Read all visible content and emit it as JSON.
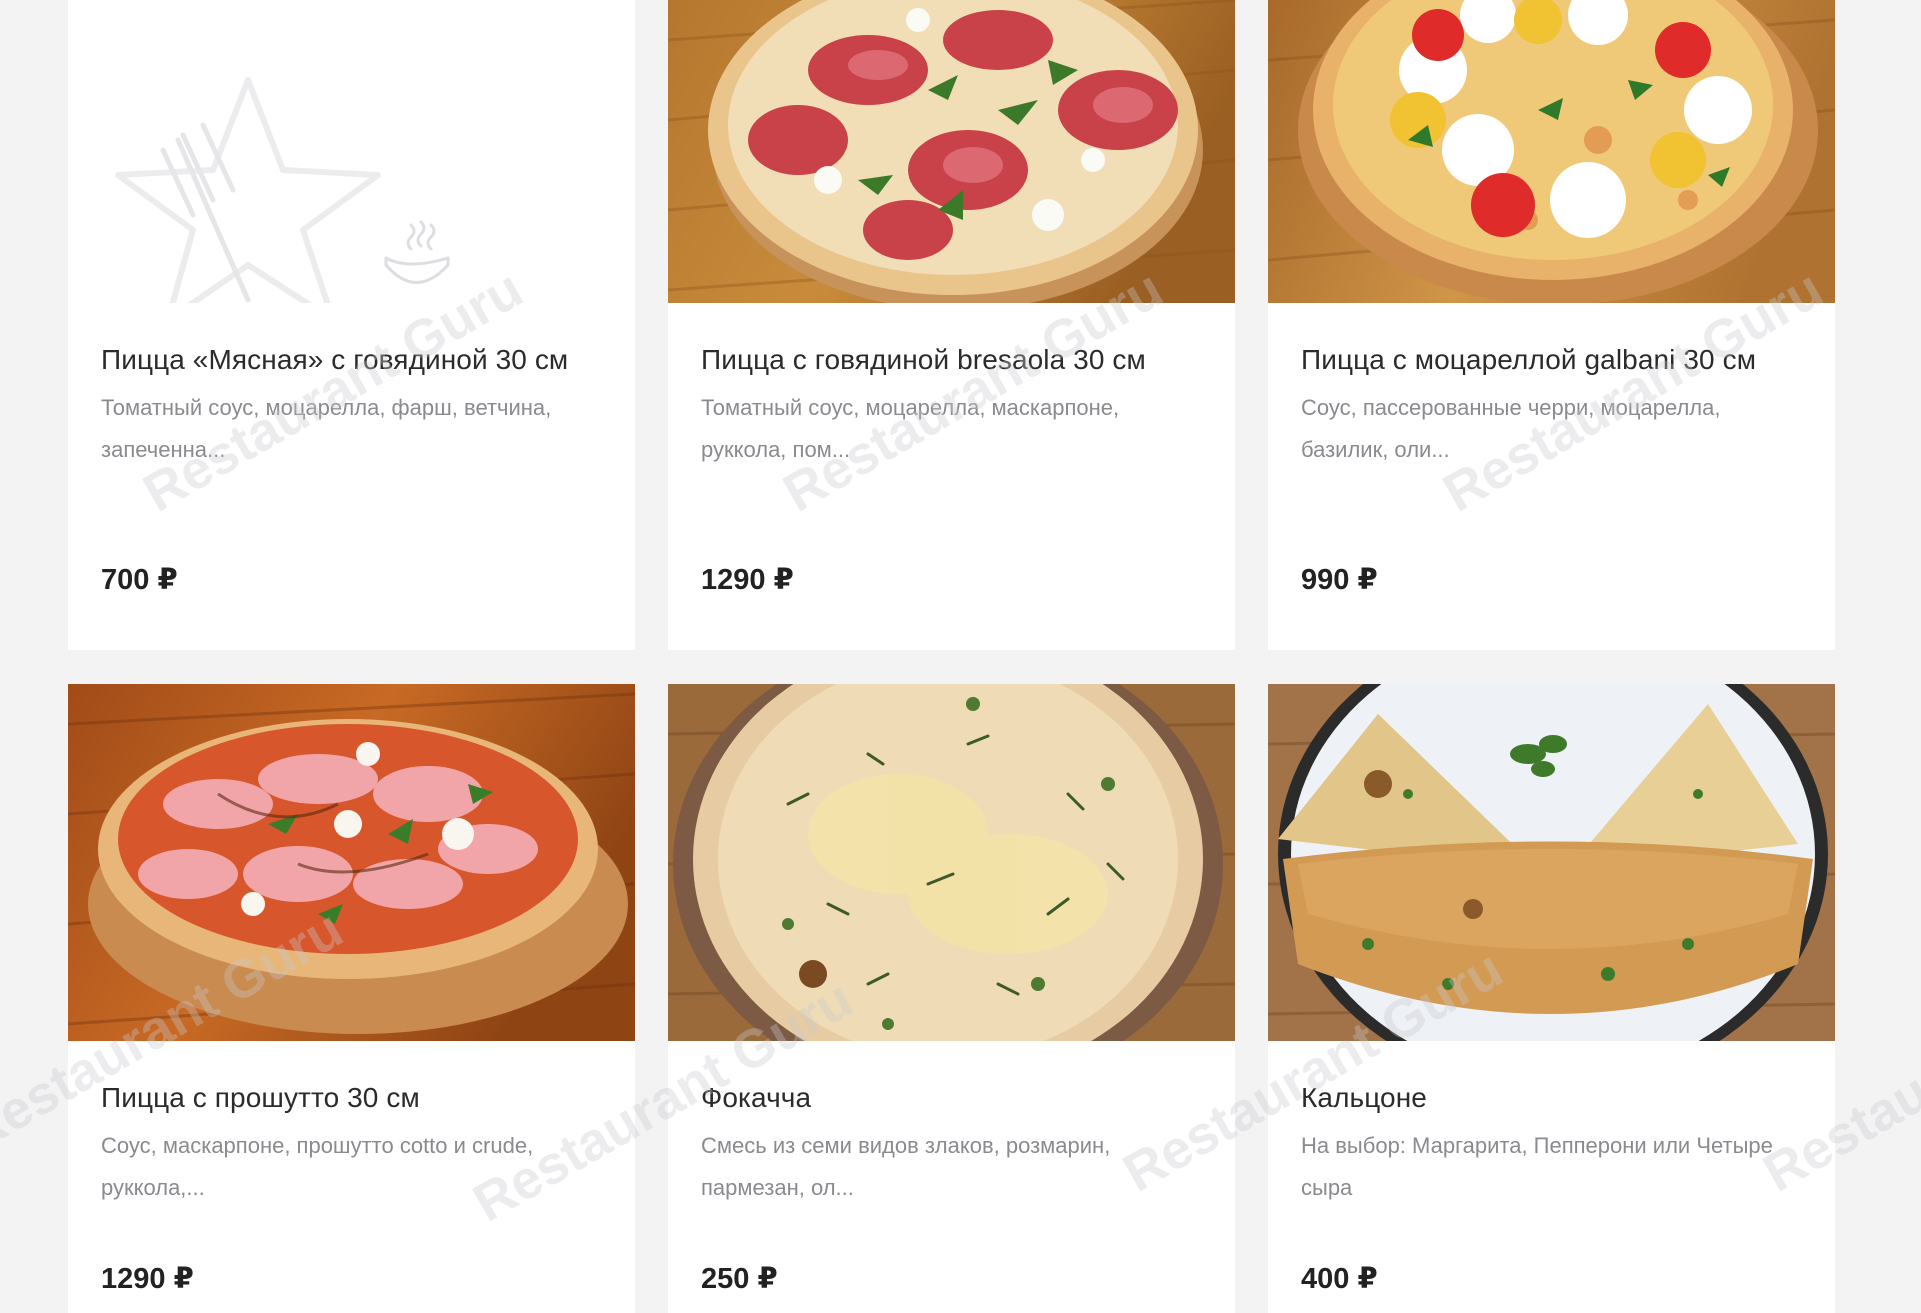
{
  "menu": {
    "items": [
      {
        "title": "Пицца «Мясная» с говядиной 30 см",
        "description": "Томатный соус, моцарелла, фарш, ветчина, запеченна...",
        "price": "700 ₽",
        "image": "placeholder-icon"
      },
      {
        "title": "Пицца с говядиной bresaola 30 см",
        "description": "Томатный соус, моцарелла, маскарпоне, руккола, пом...",
        "price": "1290 ₽",
        "image": "pizza-bresaola-photo"
      },
      {
        "title": "Пицца с моцареллой galbani 30 см",
        "description": "Соус, пассерованные черри, моцарелла, базилик, оли...",
        "price": "990 ₽",
        "image": "pizza-mozzarella-photo"
      },
      {
        "title": "Пицца с прошутто 30 см",
        "description": "Соус, маскарпоне, прошутто cotto и crude, руккола,...",
        "price": "1290 ₽",
        "image": "pizza-prosciutto-photo"
      },
      {
        "title": "Фокачча",
        "description": "Смесь из семи видов злаков, розмарин, пармезан, ол...",
        "price": "250 ₽",
        "image": "focaccia-photo"
      },
      {
        "title": "Кальцоне",
        "description": "На выбор: Маргарита, Пепперони или Четыре сыра",
        "price": "400 ₽",
        "image": "calzone-photo"
      }
    ]
  },
  "watermark": "Restaurant Guru",
  "colors": {
    "page_bg": "#f3f3f4",
    "card_bg": "#ffffff",
    "title": "#2b2b2b",
    "description": "#8a8a8f",
    "price": "#222222"
  }
}
